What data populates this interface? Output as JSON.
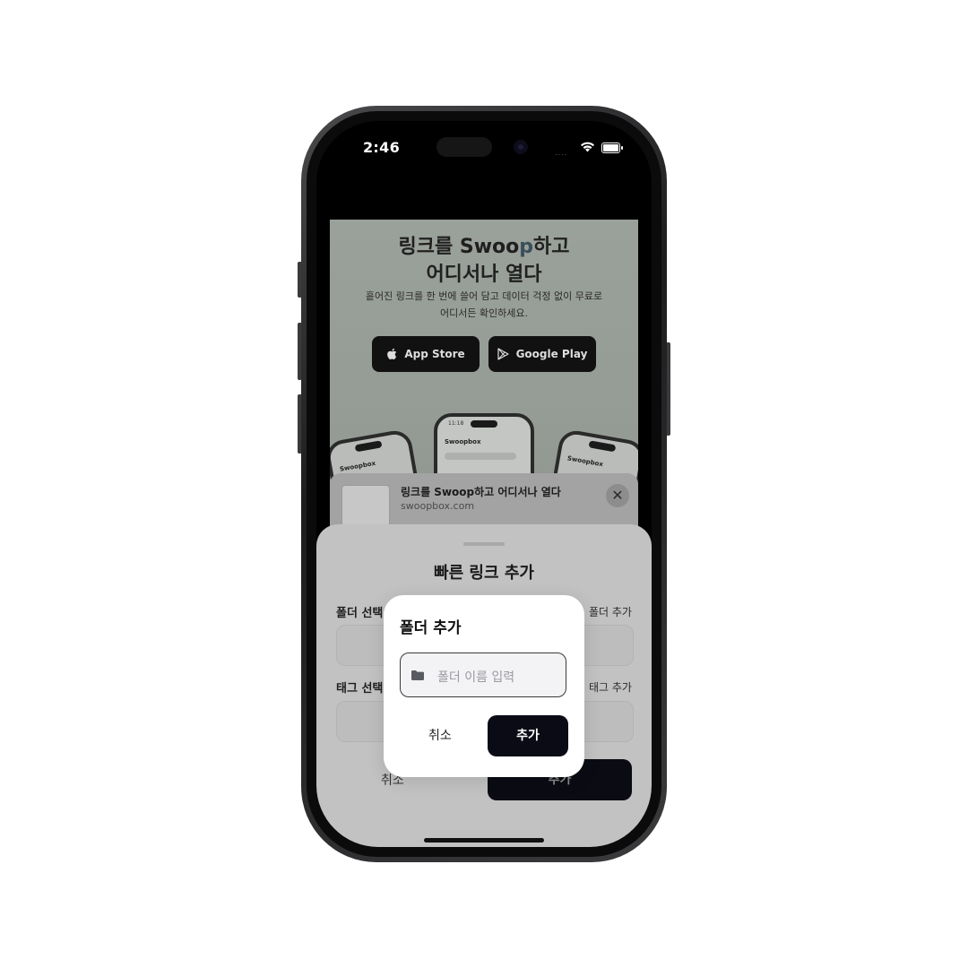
{
  "status_bar": {
    "time": "2:46",
    "signal": "....",
    "icons": [
      "wifi-icon",
      "battery-icon"
    ]
  },
  "webpage": {
    "title_line1_prefix": "링크를 ",
    "title_line1_brand_a": "Swoo",
    "title_line1_brand_b": "p",
    "title_line1_suffix": "하고",
    "title_line2": "어디서나 열다",
    "desc_line1": "흩어진 링크를 한 번에 쓸어 담고 데이터 걱정 없이 무료로",
    "desc_line2": "어디서든 확인하세요.",
    "app_store_label": "App Store",
    "google_play_label": "Google Play",
    "mockup_brand": "Swoopbox",
    "mockup_time": "11:18"
  },
  "link_banner": {
    "title": "링크를 Swoop하고 어디서나 열다",
    "url": "swoopbox.com",
    "close_symbol": "✕"
  },
  "sheet": {
    "title": "빠른 링크 추가",
    "folder_label": "폴더 선택",
    "folder_add_link": "폴더 추가",
    "tag_label": "태그 선택",
    "tag_add_link": "태그 추가",
    "cancel_label": "취소",
    "add_label": "추가"
  },
  "dialog": {
    "title": "폴더 추가",
    "input_placeholder": "폴더 이름 입력",
    "input_value": "",
    "cancel_label": "취소",
    "add_label": "추가"
  },
  "colors": {
    "primary_button": "#0b0b16",
    "sheet_bg": "#c2c2c2",
    "dialog_bg": "#ffffff"
  }
}
